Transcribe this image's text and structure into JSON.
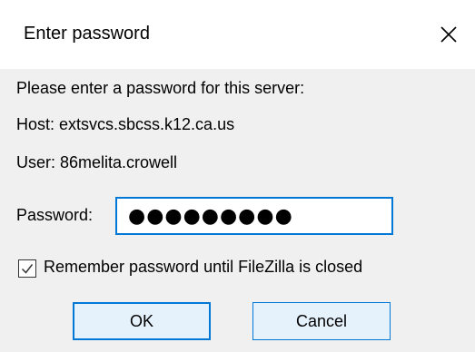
{
  "dialog": {
    "title": "Enter password",
    "prompt": "Please enter a password for this server:",
    "host_text": "Host:  extsvcs.sbcss.k12.ca.us",
    "user_text": "User:  86melita.crowell",
    "password_label": "Password:",
    "password_value": "●●●●●●●●●",
    "remember_label": "Remember password until FileZilla is closed",
    "remember_checked": true,
    "ok_label": "OK",
    "cancel_label": "Cancel"
  },
  "colors": {
    "accent": "#0078d7",
    "dialog_bg": "#f0f0f0",
    "titlebar_bg": "#ffffff"
  },
  "icons": {
    "close": "close-icon",
    "checkmark": "checkmark-icon"
  }
}
